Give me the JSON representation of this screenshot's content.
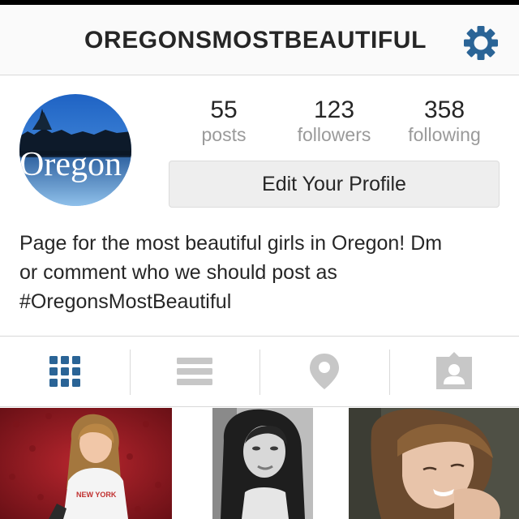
{
  "header": {
    "username": "OREGONSMOSTBEAUTIFUL",
    "settings_icon": "gear-icon"
  },
  "profile": {
    "avatar_text": "Oregon",
    "stats": [
      {
        "value": "55",
        "label": "posts"
      },
      {
        "value": "123",
        "label": "followers"
      },
      {
        "value": "358",
        "label": "following"
      }
    ],
    "edit_button_label": "Edit Your Profile",
    "bio_lines": [
      "Page for the most beautiful girls in Oregon! Dm",
      "or comment who we should post as",
      "#OregonsMostBeautiful"
    ]
  },
  "tabs": [
    {
      "icon": "grid-icon",
      "active": true
    },
    {
      "icon": "list-icon",
      "active": false
    },
    {
      "icon": "location-pin-icon",
      "active": false
    },
    {
      "icon": "tagged-person-icon",
      "active": false
    }
  ],
  "grid": {
    "photos": [
      {
        "kind": "photo",
        "shirt_text": "NEW YORK"
      },
      {
        "kind": "photo"
      },
      {
        "kind": "photo"
      }
    ]
  },
  "colors": {
    "accent_blue": "#2a6496",
    "text": "#262626",
    "muted": "#9a9a9a",
    "inactive_icon": "#c7c7c7"
  }
}
